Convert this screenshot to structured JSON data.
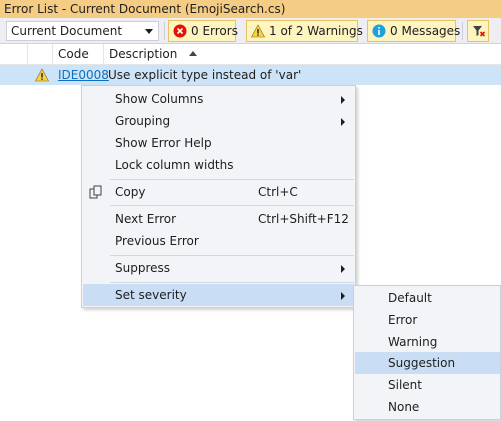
{
  "window": {
    "title": "Error List - Current Document (EmojiSearch.cs)"
  },
  "toolbar": {
    "scope_value": "Current Document",
    "errors_label": "0 Errors",
    "warnings_label": "1 of 2 Warnings",
    "messages_label": "0 Messages"
  },
  "columns": {
    "code": "Code",
    "description": "Description"
  },
  "row": {
    "code": "IDE0008",
    "description": "Use explicit type instead of 'var'"
  },
  "context_menu": {
    "show_columns": "Show Columns",
    "grouping": "Grouping",
    "show_error_help": "Show Error Help",
    "lock_column_widths": "Lock column widths",
    "copy": "Copy",
    "copy_shortcut": "Ctrl+C",
    "next_error": "Next Error",
    "next_error_shortcut": "Ctrl+Shift+F12",
    "previous_error": "Previous Error",
    "suppress": "Suppress",
    "set_severity": "Set severity"
  },
  "severity_menu": {
    "items": [
      "Default",
      "Error",
      "Warning",
      "Suggestion",
      "Silent",
      "None"
    ],
    "highlighted": "Suggestion"
  },
  "colors": {
    "title_bar": "#f5cc84",
    "selected_row": "#cde3f7",
    "menu_highlight": "#c9def5",
    "link": "#0e70c0"
  }
}
